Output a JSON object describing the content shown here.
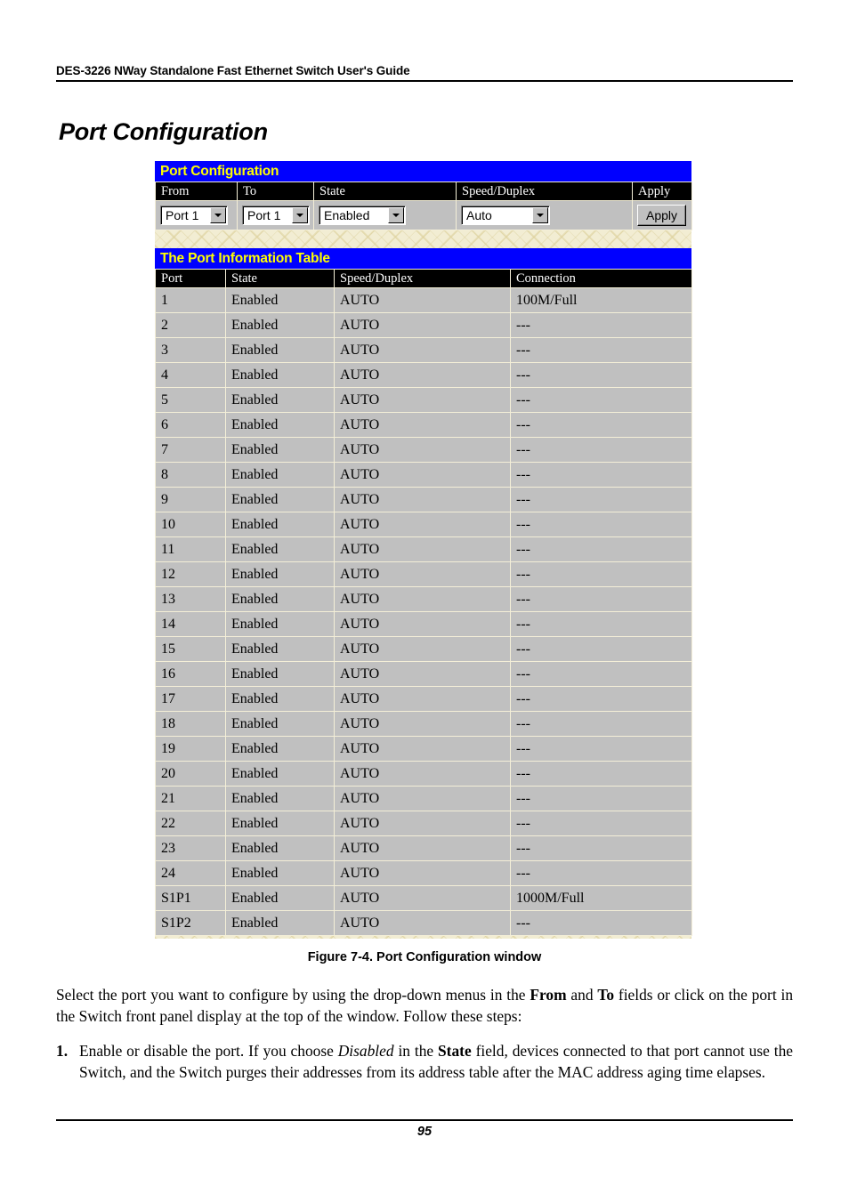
{
  "document": {
    "running_header": "DES-3226 NWay Standalone Fast Ethernet Switch User's Guide",
    "section_title": "Port Configuration",
    "figure_caption": "Figure 7-4.  Port Configuration window",
    "page_number": "95"
  },
  "figure": {
    "config_panel": {
      "title": "Port Configuration",
      "headers": {
        "from": "From",
        "to": "To",
        "state": "State",
        "speed_duplex": "Speed/Duplex",
        "apply": "Apply"
      },
      "fields": {
        "from_value": "Port 1",
        "to_value": "Port 1",
        "state_value": "Enabled",
        "speed_duplex_value": "Auto"
      },
      "apply_button_label": "Apply"
    },
    "info_table": {
      "title": "The Port Information Table",
      "columns": [
        "Port",
        "State",
        "Speed/Duplex",
        "Connection"
      ],
      "rows": [
        [
          "1",
          "Enabled",
          "AUTO",
          "100M/Full"
        ],
        [
          "2",
          "Enabled",
          "AUTO",
          "---"
        ],
        [
          "3",
          "Enabled",
          "AUTO",
          "---"
        ],
        [
          "4",
          "Enabled",
          "AUTO",
          "---"
        ],
        [
          "5",
          "Enabled",
          "AUTO",
          "---"
        ],
        [
          "6",
          "Enabled",
          "AUTO",
          "---"
        ],
        [
          "7",
          "Enabled",
          "AUTO",
          "---"
        ],
        [
          "8",
          "Enabled",
          "AUTO",
          "---"
        ],
        [
          "9",
          "Enabled",
          "AUTO",
          "---"
        ],
        [
          "10",
          "Enabled",
          "AUTO",
          "---"
        ],
        [
          "11",
          "Enabled",
          "AUTO",
          "---"
        ],
        [
          "12",
          "Enabled",
          "AUTO",
          "---"
        ],
        [
          "13",
          "Enabled",
          "AUTO",
          "---"
        ],
        [
          "14",
          "Enabled",
          "AUTO",
          "---"
        ],
        [
          "15",
          "Enabled",
          "AUTO",
          "---"
        ],
        [
          "16",
          "Enabled",
          "AUTO",
          "---"
        ],
        [
          "17",
          "Enabled",
          "AUTO",
          "---"
        ],
        [
          "18",
          "Enabled",
          "AUTO",
          "---"
        ],
        [
          "19",
          "Enabled",
          "AUTO",
          "---"
        ],
        [
          "20",
          "Enabled",
          "AUTO",
          "---"
        ],
        [
          "21",
          "Enabled",
          "AUTO",
          "---"
        ],
        [
          "22",
          "Enabled",
          "AUTO",
          "---"
        ],
        [
          "23",
          "Enabled",
          "AUTO",
          "---"
        ],
        [
          "24",
          "Enabled",
          "AUTO",
          "---"
        ],
        [
          "S1P1",
          "Enabled",
          "AUTO",
          "1000M/Full"
        ],
        [
          "S1P2",
          "Enabled",
          "AUTO",
          "---"
        ]
      ]
    }
  },
  "body": {
    "intro_part1": "Select the port you want to configure by using the drop-down menus in the ",
    "intro_from": "From",
    "intro_part2": " and ",
    "intro_to": "To",
    "intro_part3": " fields or click on the port in the Switch front panel display at the top of the window. Follow these steps:",
    "step1_num": "1.",
    "step1_part1": "Enable or disable the port. If you choose ",
    "step1_disabled": "Disabled",
    "step1_part2": " in the ",
    "step1_state": "State",
    "step1_part3": " field, devices connected to that port cannot use the Switch, and the Switch purges their addresses from its address table after the MAC address aging time elapses."
  },
  "colors": {
    "title_bar_bg": "#0000ff",
    "title_bar_text": "#ffff00",
    "header_row_bg": "#000000",
    "cell_bg": "#c0c0c0",
    "grid_line": "#f4efd8",
    "page_bg": "#f2edd3"
  }
}
